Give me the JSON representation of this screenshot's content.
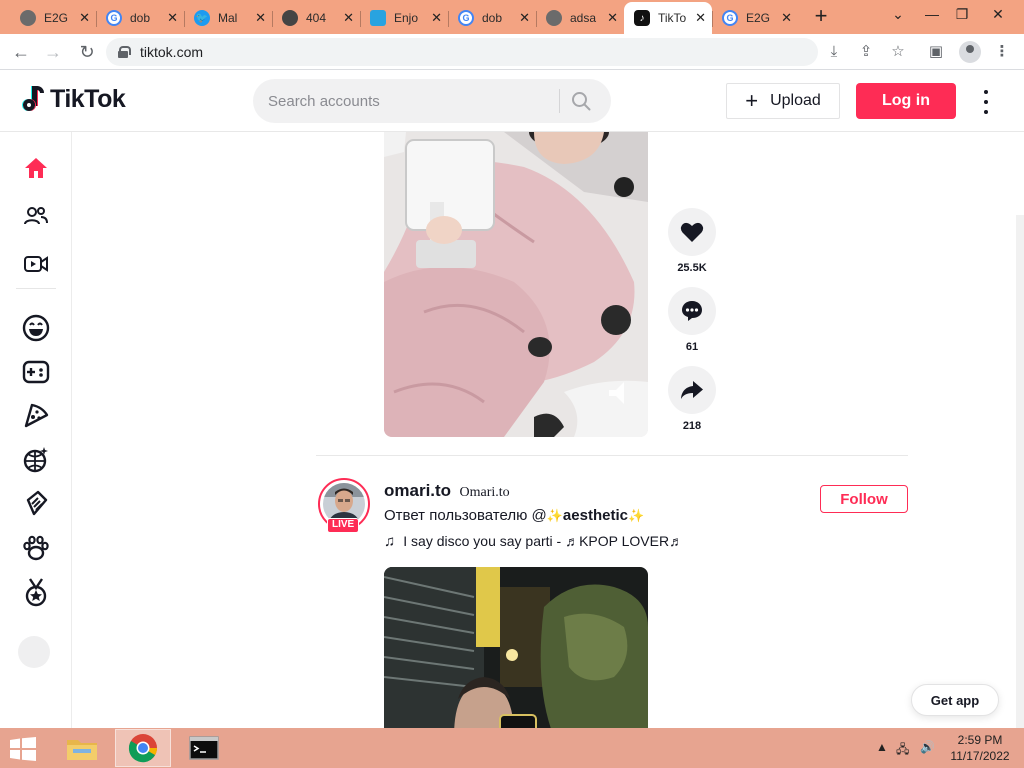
{
  "browser": {
    "tabs": [
      {
        "title": "E2G",
        "favicon": "globe-icon",
        "active": false
      },
      {
        "title": "dob",
        "favicon": "google-icon",
        "active": false
      },
      {
        "title": "Mal",
        "favicon": "twitter-icon",
        "active": false
      },
      {
        "title": "404",
        "favicon": "github-icon",
        "active": false
      },
      {
        "title": "Enjo",
        "favicon": "document-icon",
        "active": false
      },
      {
        "title": "dob",
        "favicon": "google-icon",
        "active": false
      },
      {
        "title": "adsa",
        "favicon": "globe-icon",
        "active": false
      },
      {
        "title": "TikTo",
        "favicon": "tiktok-icon",
        "active": true
      },
      {
        "title": "E2G",
        "favicon": "google-icon",
        "active": false
      }
    ],
    "new_tab_label": "+",
    "url": "tiktok.com",
    "tab_strip_color": "#f3a382"
  },
  "tiktok": {
    "logo_text": "TikTok",
    "search_placeholder": "Search accounts",
    "upload_label": "Upload",
    "login_label": "Log in",
    "accent": "#fe2c55",
    "sidebar_icons": [
      "home-icon",
      "following-icon",
      "live-icon",
      "comedy-icon",
      "gaming-icon",
      "food-icon",
      "dance-icon",
      "beauty-icon",
      "animals-icon",
      "sports-icon"
    ],
    "video1_actions": {
      "likes": "25.5K",
      "comments": "61",
      "shares": "218"
    },
    "post2": {
      "handle": "omari.to",
      "nickname": "Omari.to",
      "live_label": "LIVE",
      "caption_prefix": "Ответ пользователю @",
      "caption_mention": "aesthetic",
      "sparkle": "✨",
      "music": "I say disco you say parti - ♬KPOP LOVER♬",
      "follow_label": "Follow"
    },
    "get_app_label": "Get app"
  },
  "taskbar": {
    "time": "2:59 PM",
    "date": "11/17/2022",
    "apps": [
      "file-explorer-icon",
      "chrome-icon",
      "terminal-icon"
    ]
  }
}
